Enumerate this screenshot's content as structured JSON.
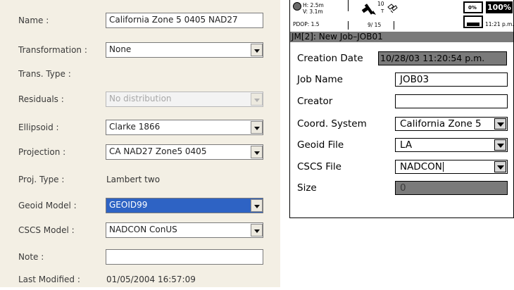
{
  "left_panel": {
    "rows": [
      {
        "label": "Name :",
        "value": "California Zone 5 0405 NAD27"
      },
      {
        "label": "Transformation :",
        "value": "None"
      },
      {
        "label": "Trans. Type :",
        "value": ""
      },
      {
        "label": "Residuals :",
        "value": "No distribution"
      },
      {
        "label": "Ellipsoid :",
        "value": "Clarke 1866"
      },
      {
        "label": "Projection :",
        "value": "CA NAD27 Zone5 0405"
      },
      {
        "label": "Proj. Type :",
        "value": "Lambert two"
      },
      {
        "label": "Geoid Model :",
        "value": "GEOID99"
      },
      {
        "label": "CSCS Model :",
        "value": "NADCON ConUS"
      },
      {
        "label": "Note :",
        "value": ""
      },
      {
        "label": "Last Modified :",
        "value": "01/05/2004 16:57:09"
      }
    ]
  },
  "device": {
    "status": {
      "h_error": "H: 2.5m",
      "v_error": "V: 3.1m",
      "pdop": "PDOP: 1.5",
      "sat_count": "9/ 15",
      "sat_top": "10",
      "sat_letter": "T",
      "battery_small": "0%",
      "battery_main": "100%",
      "clock": "11:21 p.m."
    },
    "title": "JM[2]: New Job–JOB01",
    "rows": [
      {
        "label": "Creation Date",
        "value": "10/28/03 11:20:54 p.m."
      },
      {
        "label": "Job Name",
        "value": "JOB03"
      },
      {
        "label": "Creator",
        "value": ""
      },
      {
        "label": "Coord. System",
        "value": "California Zone 5"
      },
      {
        "label": "Geoid File",
        "value": "LA"
      },
      {
        "label": "CSCS File",
        "value": "NADCON"
      },
      {
        "label": "Size",
        "value": "0"
      }
    ]
  }
}
